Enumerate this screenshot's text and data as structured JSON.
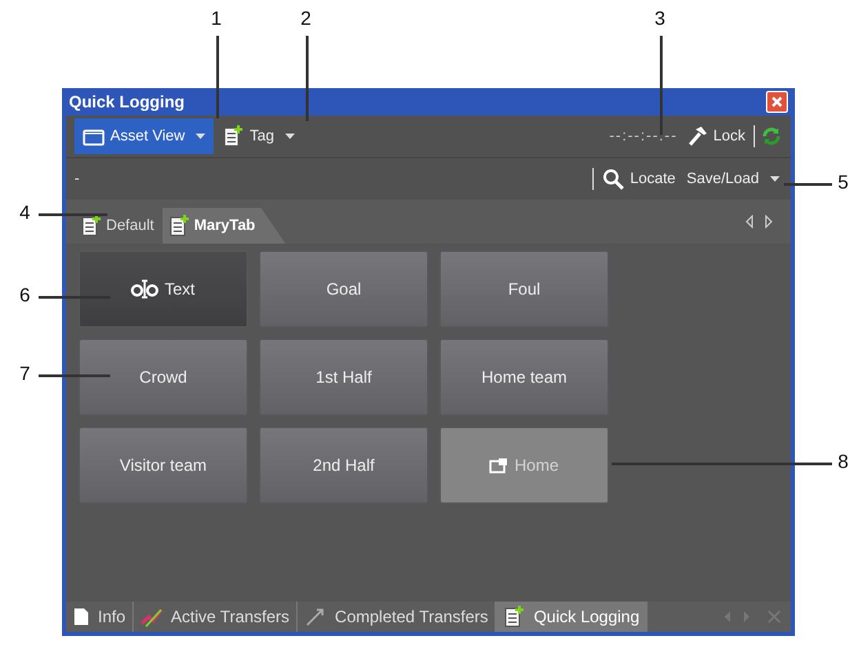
{
  "window": {
    "title": "Quick Logging"
  },
  "toolbar": {
    "asset_view": "Asset View",
    "tag": "Tag",
    "timecode": "--:--:--:--",
    "lock": "Lock"
  },
  "toolbar2": {
    "status": "-",
    "locate": "Locate",
    "save_load": "Save/Load"
  },
  "tabs": [
    {
      "label": "Default",
      "selected": false
    },
    {
      "label": "MaryTab",
      "selected": true
    }
  ],
  "buttons": [
    {
      "label": "Text",
      "kind": "text"
    },
    {
      "label": "Goal",
      "kind": "normal"
    },
    {
      "label": "Foul",
      "kind": "normal"
    },
    {
      "label": "Crowd",
      "kind": "normal"
    },
    {
      "label": "1st Half",
      "kind": "normal"
    },
    {
      "label": "Home team",
      "kind": "normal"
    },
    {
      "label": "Visitor team",
      "kind": "normal"
    },
    {
      "label": "2nd Half",
      "kind": "normal"
    },
    {
      "label": "Home",
      "kind": "ghost"
    }
  ],
  "bottom_tabs": [
    {
      "label": "Info",
      "selected": false
    },
    {
      "label": "Active Transfers",
      "selected": false
    },
    {
      "label": "Completed Transfers",
      "selected": false
    },
    {
      "label": "Quick Logging",
      "selected": true
    }
  ],
  "callouts": [
    {
      "label": "1"
    },
    {
      "label": "2"
    },
    {
      "label": "3"
    },
    {
      "label": "4"
    },
    {
      "label": "5"
    },
    {
      "label": "6"
    },
    {
      "label": "7"
    },
    {
      "label": "8"
    }
  ]
}
